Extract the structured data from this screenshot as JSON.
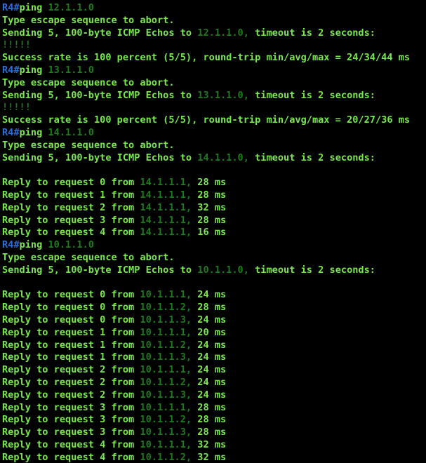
{
  "terminal": {
    "colors": {
      "background": "#000000",
      "text": "#78e84c",
      "prompt": "#2e6fd8",
      "ip": "#1d7a1d"
    },
    "lines": [
      [
        {
          "t": "R4#",
          "c": "prompt"
        },
        {
          "t": "ping ",
          "c": "cmd"
        },
        {
          "t": "12.1.1.0",
          "c": "ip"
        }
      ],
      [
        {
          "t": "Type escape sequence to abort.",
          "c": "text"
        }
      ],
      [
        {
          "t": "Sending 5, 100-byte ICMP Echos to ",
          "c": "text"
        },
        {
          "t": "12.1.1.0,",
          "c": "ip"
        },
        {
          "t": " timeout is 2 seconds:",
          "c": "text"
        }
      ],
      [
        {
          "t": "!!!!!",
          "c": "bang"
        }
      ],
      [
        {
          "t": "Success rate is 100 percent (5/5), round-trip min/avg/max = 24/34/44 ms",
          "c": "text"
        }
      ],
      [
        {
          "t": "R4#",
          "c": "prompt"
        },
        {
          "t": "ping ",
          "c": "cmd"
        },
        {
          "t": "13.1.1.0",
          "c": "ip"
        }
      ],
      [
        {
          "t": "Type escape sequence to abort.",
          "c": "text"
        }
      ],
      [
        {
          "t": "Sending 5, 100-byte ICMP Echos to ",
          "c": "text"
        },
        {
          "t": "13.1.1.0,",
          "c": "ip"
        },
        {
          "t": " timeout is 2 seconds:",
          "c": "text"
        }
      ],
      [
        {
          "t": "!!!!!",
          "c": "bang"
        }
      ],
      [
        {
          "t": "Success rate is 100 percent (5/5), round-trip min/avg/max = 20/27/36 ms",
          "c": "text"
        }
      ],
      [
        {
          "t": "R4#",
          "c": "prompt"
        },
        {
          "t": "ping ",
          "c": "cmd"
        },
        {
          "t": "14.1.1.0",
          "c": "ip"
        }
      ],
      [
        {
          "t": "Type escape sequence to abort.",
          "c": "text"
        }
      ],
      [
        {
          "t": "Sending 5, 100-byte ICMP Echos to ",
          "c": "text"
        },
        {
          "t": "14.1.1.0,",
          "c": "ip"
        },
        {
          "t": " timeout is 2 seconds:",
          "c": "text"
        }
      ],
      [],
      [
        {
          "t": "Reply to request 0 from ",
          "c": "text"
        },
        {
          "t": "14.1.1.1,",
          "c": "ip"
        },
        {
          "t": " 28 ms",
          "c": "text"
        }
      ],
      [
        {
          "t": "Reply to request 1 from ",
          "c": "text"
        },
        {
          "t": "14.1.1.1,",
          "c": "ip"
        },
        {
          "t": " 28 ms",
          "c": "text"
        }
      ],
      [
        {
          "t": "Reply to request 2 from ",
          "c": "text"
        },
        {
          "t": "14.1.1.1,",
          "c": "ip"
        },
        {
          "t": " 32 ms",
          "c": "text"
        }
      ],
      [
        {
          "t": "Reply to request 3 from ",
          "c": "text"
        },
        {
          "t": "14.1.1.1,",
          "c": "ip"
        },
        {
          "t": " 28 ms",
          "c": "text"
        }
      ],
      [
        {
          "t": "Reply to request 4 from ",
          "c": "text"
        },
        {
          "t": "14.1.1.1,",
          "c": "ip"
        },
        {
          "t": " 16 ms",
          "c": "text"
        }
      ],
      [
        {
          "t": "R4#",
          "c": "prompt"
        },
        {
          "t": "ping ",
          "c": "cmd"
        },
        {
          "t": "10.1.1.0",
          "c": "ip"
        }
      ],
      [
        {
          "t": "Type escape sequence to abort.",
          "c": "text"
        }
      ],
      [
        {
          "t": "Sending 5, 100-byte ICMP Echos to ",
          "c": "text"
        },
        {
          "t": "10.1.1.0,",
          "c": "ip"
        },
        {
          "t": " timeout is 2 seconds:",
          "c": "text"
        }
      ],
      [],
      [
        {
          "t": "Reply to request 0 from ",
          "c": "text"
        },
        {
          "t": "10.1.1.1,",
          "c": "ip"
        },
        {
          "t": " 24 ms",
          "c": "text"
        }
      ],
      [
        {
          "t": "Reply to request 0 from ",
          "c": "text"
        },
        {
          "t": "10.1.1.2,",
          "c": "ip"
        },
        {
          "t": " 28 ms",
          "c": "text"
        }
      ],
      [
        {
          "t": "Reply to request 0 from ",
          "c": "text"
        },
        {
          "t": "10.1.1.3,",
          "c": "ip"
        },
        {
          "t": " 24 ms",
          "c": "text"
        }
      ],
      [
        {
          "t": "Reply to request 1 from ",
          "c": "text"
        },
        {
          "t": "10.1.1.1,",
          "c": "ip"
        },
        {
          "t": " 20 ms",
          "c": "text"
        }
      ],
      [
        {
          "t": "Reply to request 1 from ",
          "c": "text"
        },
        {
          "t": "10.1.1.2,",
          "c": "ip"
        },
        {
          "t": " 24 ms",
          "c": "text"
        }
      ],
      [
        {
          "t": "Reply to request 1 from ",
          "c": "text"
        },
        {
          "t": "10.1.1.3,",
          "c": "ip"
        },
        {
          "t": " 24 ms",
          "c": "text"
        }
      ],
      [
        {
          "t": "Reply to request 2 from ",
          "c": "text"
        },
        {
          "t": "10.1.1.1,",
          "c": "ip"
        },
        {
          "t": " 24 ms",
          "c": "text"
        }
      ],
      [
        {
          "t": "Reply to request 2 from ",
          "c": "text"
        },
        {
          "t": "10.1.1.2,",
          "c": "ip"
        },
        {
          "t": " 24 ms",
          "c": "text"
        }
      ],
      [
        {
          "t": "Reply to request 2 from ",
          "c": "text"
        },
        {
          "t": "10.1.1.3,",
          "c": "ip"
        },
        {
          "t": " 24 ms",
          "c": "text"
        }
      ],
      [
        {
          "t": "Reply to request 3 from ",
          "c": "text"
        },
        {
          "t": "10.1.1.1,",
          "c": "ip"
        },
        {
          "t": " 28 ms",
          "c": "text"
        }
      ],
      [
        {
          "t": "Reply to request 3 from ",
          "c": "text"
        },
        {
          "t": "10.1.1.2,",
          "c": "ip"
        },
        {
          "t": " 28 ms",
          "c": "text"
        }
      ],
      [
        {
          "t": "Reply to request 3 from ",
          "c": "text"
        },
        {
          "t": "10.1.1.3,",
          "c": "ip"
        },
        {
          "t": " 28 ms",
          "c": "text"
        }
      ],
      [
        {
          "t": "Reply to request 4 from ",
          "c": "text"
        },
        {
          "t": "10.1.1.1,",
          "c": "ip"
        },
        {
          "t": " 32 ms",
          "c": "text"
        }
      ],
      [
        {
          "t": "Reply to request 4 from ",
          "c": "text"
        },
        {
          "t": "10.1.1.2,",
          "c": "ip"
        },
        {
          "t": " 32 ms",
          "c": "text"
        }
      ]
    ]
  }
}
